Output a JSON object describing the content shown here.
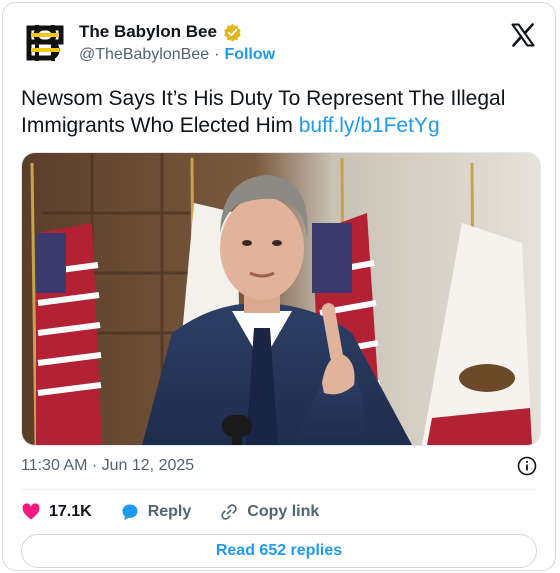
{
  "account": {
    "name": "The Babylon Bee",
    "handle": "@TheBabylonBee",
    "separator": "·",
    "follow_label": "Follow"
  },
  "tweet": {
    "text": "Newsom Says It’s His Duty To Represent The Illegal Immigrants Who Elected Him",
    "link": "buff.ly/b1FetYg"
  },
  "meta": {
    "time": "11:30 AM · Jun 12, 2025"
  },
  "actions": {
    "likes_count": "17.1K",
    "reply_label": "Reply",
    "copy_link_label": "Copy link"
  },
  "read_replies_label": "Read 652 replies",
  "icons": {
    "logo": "babylon-bee-logo",
    "verified": "gold-verified-badge-icon",
    "x": "x-logo-icon",
    "info": "info-icon",
    "like": "heart-icon",
    "reply": "reply-bubble-icon",
    "copy": "link-icon"
  },
  "colors": {
    "brand_blue": "#1d9bf0",
    "verified_gold": "#e2b719",
    "like_pink": "#f91880",
    "text": "#0f1419",
    "muted": "#536471"
  }
}
